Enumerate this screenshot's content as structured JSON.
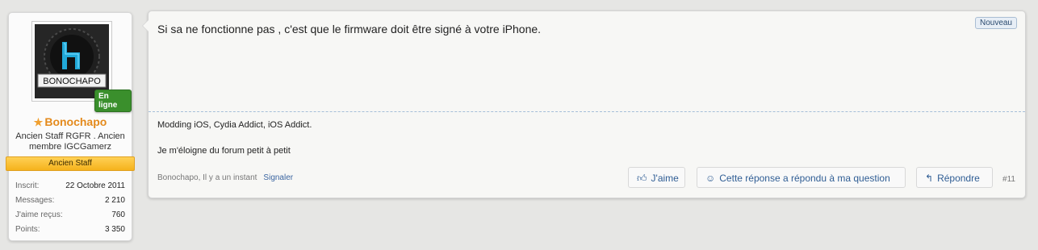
{
  "user": {
    "logo_text": "BONOCHAPO",
    "online_badge": "En ligne",
    "username": "Bonochapo",
    "title": "Ancien Staff RGFR . Ancien membre IGCGamerz",
    "role": "Ancien Staff",
    "stats": [
      {
        "label": "Inscrit:",
        "value": "22 Octobre 2011"
      },
      {
        "label": "Messages:",
        "value": "2 210"
      },
      {
        "label": "J'aime reçus:",
        "value": "760"
      },
      {
        "label": "Points:",
        "value": "3 350"
      }
    ]
  },
  "post": {
    "new_badge": "Nouveau",
    "body": "Si sa ne fonctionne pas , c'est que le firmware doit être signé à votre iPhone.",
    "signature_line1": "Modding iOS, Cydia Addict, iOS Addict.",
    "signature_line2": "Je m'éloigne du forum petit à petit",
    "meta": "Bonochapo, Il y a un instant",
    "report_label": "Signaler",
    "like_label": "J'aime",
    "answer_label": "Cette réponse a répondu à ma question",
    "reply_label": "Répondre",
    "post_number": "#11"
  },
  "colors": {
    "username": "#e48a1c",
    "online": "#3a8f2c",
    "role_banner": "#f5b21c",
    "link": "#2f5d94"
  },
  "icons": {
    "star": "star-icon",
    "like": "thumbs-up-icon",
    "answer": "smiley-icon",
    "reply": "reply-arrow-icon"
  }
}
